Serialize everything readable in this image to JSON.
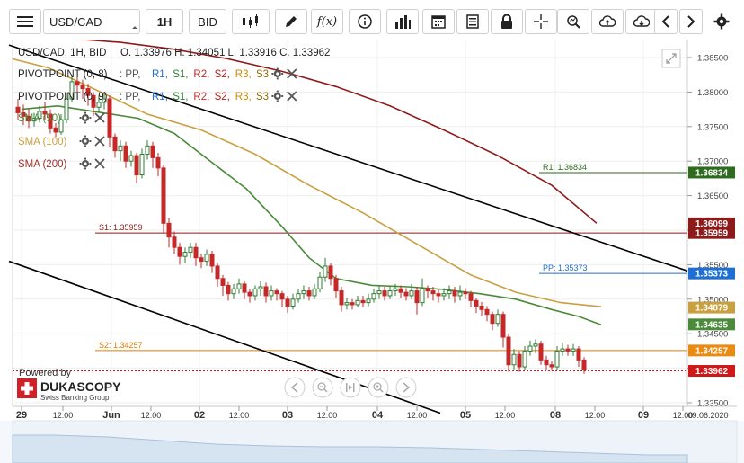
{
  "toolbar": {
    "symbol": "USD/CAD",
    "timeframe": "1H",
    "side": "BID",
    "indicator_btn": "f(x)"
  },
  "header": {
    "instrument_line": "USD/CAD, 1H, BID",
    "ohlc": "O. 1.33976 H. 1.34051 L. 1.33916 C. 1.33962"
  },
  "indicators": [
    {
      "label": "PIVOTPOINT (0, 8)",
      "parts": [
        ": PP,",
        "R1,",
        "S1,",
        "R2,",
        "S2,",
        "R3,",
        "S3"
      ],
      "colors": [
        "#555555",
        "#1e6fd1",
        "#2e7d32",
        "#c62828",
        "#b71c1c",
        "#d08a00",
        "#8a6d00",
        "#e6c200"
      ]
    },
    {
      "label": "PIVOTPOINT (0, 9)",
      "parts": [
        ": PP,",
        "R1,",
        "S1,",
        "R2,",
        "S2,",
        "R3,",
        "S3"
      ],
      "colors": [
        "#555555",
        "#1e6fd1",
        "#2e7d32",
        "#c62828",
        "#b71c1c",
        "#d08a00",
        "#8a6d00",
        "#e6c200"
      ]
    },
    {
      "label": "SMA (50)",
      "color": "#4a8a3a"
    },
    {
      "label": "SMA (100)",
      "color": "#c8a040"
    },
    {
      "label": "SMA (200)",
      "color": "#a0302c"
    }
  ],
  "branding": {
    "powered_by": "Powered by",
    "name": "DUKASCOPY",
    "tagline": "Swiss Banking Group"
  },
  "chart_data": {
    "type": "candlestick",
    "y_ticks": [
      "1.38500",
      "1.38000",
      "1.37500",
      "1.37000",
      "1.36500",
      "1.36000",
      "1.35500",
      "1.35000",
      "1.34500",
      "1.34000",
      "1.33500"
    ],
    "ylim": [
      1.3335,
      1.3875
    ],
    "x_ticks": [
      "29",
      "12:00",
      "Jun",
      "12:00",
      "02",
      "12:00",
      "03",
      "12:00",
      "04",
      "12:00",
      "05",
      "12:00",
      "08",
      "12:00",
      "09",
      "12:00"
    ],
    "x_end_label": "09.06.2020",
    "levels": [
      {
        "name": "R1",
        "label": "R1: 1.36834",
        "value": 1.36834,
        "color": "#2e6b1f",
        "badge": "1.36834"
      },
      {
        "name": "S1",
        "label": "S1: 1.35959",
        "value": 1.35959,
        "color": "#8b1a1a",
        "badge": "1.35959"
      },
      {
        "name": "PP",
        "label": "PP: 1.35373",
        "value": 1.35373,
        "color": "#1e6fd1",
        "badge": "1.35373"
      },
      {
        "name": "S2",
        "label": "S2: 1.34257",
        "value": 1.34257,
        "color": "#e07b00",
        "badge": "1.34257"
      }
    ],
    "sma_badges": [
      {
        "name": "SMA (200)",
        "value": 1.36099,
        "badge": "1.36099",
        "color": "#8b1a1a"
      },
      {
        "name": "SMA (100)",
        "value": 1.34879,
        "badge": "1.34879",
        "color": "#c8a040"
      },
      {
        "name": "SMA (50)",
        "value": 1.34635,
        "badge": "1.34635",
        "color": "#4a8a3a"
      }
    ],
    "last_price": {
      "value": 1.33962,
      "badge": "1.33962",
      "color": "#d01818"
    },
    "sma200": [
      [
        0,
        1.3885
      ],
      [
        60,
        1.3878
      ],
      [
        120,
        1.3872
      ],
      [
        180,
        1.3862
      ],
      [
        240,
        1.3848
      ],
      [
        300,
        1.383
      ],
      [
        360,
        1.3808
      ],
      [
        420,
        1.378
      ],
      [
        480,
        1.3745
      ],
      [
        540,
        1.3708
      ],
      [
        600,
        1.3665
      ],
      [
        650,
        1.361
      ]
    ],
    "sma100": [
      [
        0,
        1.3848
      ],
      [
        40,
        1.3835
      ],
      [
        90,
        1.3805
      ],
      [
        150,
        1.3768
      ],
      [
        210,
        1.3745
      ],
      [
        270,
        1.371
      ],
      [
        330,
        1.3665
      ],
      [
        390,
        1.3625
      ],
      [
        450,
        1.358
      ],
      [
        510,
        1.3535
      ],
      [
        560,
        1.351
      ],
      [
        610,
        1.3495
      ],
      [
        655,
        1.3489
      ]
    ],
    "sma50": [
      [
        10,
        1.3775
      ],
      [
        50,
        1.378
      ],
      [
        90,
        1.3772
      ],
      [
        140,
        1.3762
      ],
      [
        180,
        1.374
      ],
      [
        220,
        1.37
      ],
      [
        260,
        1.366
      ],
      [
        300,
        1.3605
      ],
      [
        330,
        1.356
      ],
      [
        360,
        1.353
      ],
      [
        400,
        1.352
      ],
      [
        440,
        1.3518
      ],
      [
        480,
        1.3514
      ],
      [
        520,
        1.3508
      ],
      [
        560,
        1.35
      ],
      [
        600,
        1.3485
      ],
      [
        630,
        1.3475
      ],
      [
        655,
        1.3463
      ]
    ],
    "trend_upper": [
      [
        10,
        1.3868
      ],
      [
        765,
        1.3541
      ]
    ],
    "trend_lower": [
      [
        10,
        1.3555
      ],
      [
        490,
        1.3335
      ]
    ],
    "candles": [
      [
        20,
        1.3778,
        1.377,
        1.379,
        1.376
      ],
      [
        26,
        1.377,
        1.3765,
        1.3782,
        1.3752
      ],
      [
        32,
        1.3765,
        1.3758,
        1.3775,
        1.3748
      ],
      [
        38,
        1.3758,
        1.3762,
        1.377,
        1.375
      ],
      [
        44,
        1.3762,
        1.3772,
        1.378,
        1.3756
      ],
      [
        50,
        1.3772,
        1.3768,
        1.3785,
        1.376
      ],
      [
        56,
        1.3768,
        1.3748,
        1.3775,
        1.374
      ],
      [
        62,
        1.3748,
        1.3742,
        1.3755,
        1.3735
      ],
      [
        68,
        1.3742,
        1.376,
        1.3768,
        1.3738
      ],
      [
        74,
        1.376,
        1.379,
        1.3798,
        1.3755
      ],
      [
        80,
        1.379,
        1.3815,
        1.3825,
        1.3785
      ],
      [
        86,
        1.3815,
        1.381,
        1.3822,
        1.38
      ],
      [
        92,
        1.381,
        1.3805,
        1.3818,
        1.379
      ],
      [
        98,
        1.3805,
        1.3795,
        1.3812,
        1.378
      ],
      [
        104,
        1.3795,
        1.3778,
        1.38,
        1.3765
      ],
      [
        110,
        1.3778,
        1.3785,
        1.3795,
        1.377
      ],
      [
        116,
        1.3785,
        1.379,
        1.38,
        1.3775
      ],
      [
        122,
        1.379,
        1.3735,
        1.3795,
        1.372
      ],
      [
        128,
        1.3735,
        1.3715,
        1.374,
        1.3705
      ],
      [
        134,
        1.3715,
        1.3722,
        1.373,
        1.37
      ],
      [
        140,
        1.3722,
        1.37,
        1.3728,
        1.369
      ],
      [
        146,
        1.37,
        1.3708,
        1.3715,
        1.3692
      ],
      [
        152,
        1.3708,
        1.368,
        1.3712,
        1.3668
      ],
      [
        158,
        1.368,
        1.371,
        1.3718,
        1.3675
      ],
      [
        164,
        1.371,
        1.3722,
        1.373,
        1.3702
      ],
      [
        170,
        1.3722,
        1.3705,
        1.3728,
        1.369
      ],
      [
        176,
        1.3705,
        1.369,
        1.3712,
        1.3678
      ],
      [
        182,
        1.369,
        1.361,
        1.3695,
        1.3595
      ],
      [
        188,
        1.361,
        1.359,
        1.3618,
        1.3575
      ],
      [
        194,
        1.359,
        1.3575,
        1.3598,
        1.3565
      ],
      [
        200,
        1.3575,
        1.3562,
        1.3582,
        1.355
      ],
      [
        206,
        1.3562,
        1.3568,
        1.3575,
        1.3552
      ],
      [
        212,
        1.3568,
        1.3575,
        1.3582,
        1.356
      ],
      [
        218,
        1.3575,
        1.356,
        1.3582,
        1.3548
      ],
      [
        224,
        1.356,
        1.3555,
        1.3566,
        1.3545
      ],
      [
        230,
        1.3555,
        1.3565,
        1.3572,
        1.3548
      ],
      [
        236,
        1.3565,
        1.3548,
        1.357,
        1.3538
      ],
      [
        242,
        1.3548,
        1.353,
        1.3552,
        1.3518
      ],
      [
        248,
        1.353,
        1.352,
        1.3535,
        1.3505
      ],
      [
        254,
        1.352,
        1.3508,
        1.3525,
        1.3498
      ],
      [
        260,
        1.3508,
        1.3515,
        1.3522,
        1.35
      ],
      [
        266,
        1.3515,
        1.3522,
        1.353,
        1.3508
      ],
      [
        272,
        1.3522,
        1.351,
        1.3526,
        1.35
      ],
      [
        278,
        1.351,
        1.3505,
        1.3515,
        1.3495
      ],
      [
        284,
        1.3505,
        1.3515,
        1.352,
        1.3498
      ],
      [
        290,
        1.3515,
        1.3518,
        1.3526,
        1.3505
      ],
      [
        296,
        1.3518,
        1.3505,
        1.3524,
        1.3495
      ],
      [
        302,
        1.3505,
        1.3512,
        1.352,
        1.3498
      ],
      [
        308,
        1.3512,
        1.3508,
        1.3516,
        1.3498
      ],
      [
        314,
        1.3508,
        1.35,
        1.3512,
        1.3488
      ],
      [
        320,
        1.35,
        1.349,
        1.3505,
        1.348
      ],
      [
        326,
        1.349,
        1.35,
        1.3508,
        1.3485
      ],
      [
        332,
        1.35,
        1.3508,
        1.3515,
        1.3495
      ],
      [
        338,
        1.3508,
        1.3512,
        1.352,
        1.35
      ],
      [
        344,
        1.3512,
        1.3505,
        1.3518,
        1.3498
      ],
      [
        350,
        1.3505,
        1.3515,
        1.3522,
        1.35
      ],
      [
        356,
        1.3515,
        1.3532,
        1.354,
        1.351
      ],
      [
        362,
        1.3532,
        1.3548,
        1.356,
        1.3525
      ],
      [
        368,
        1.3548,
        1.353,
        1.3552,
        1.352
      ],
      [
        374,
        1.353,
        1.3512,
        1.3535,
        1.3502
      ],
      [
        380,
        1.3512,
        1.3492,
        1.3518,
        1.3482
      ],
      [
        386,
        1.3492,
        1.3495,
        1.3502,
        1.3485
      ],
      [
        392,
        1.3495,
        1.3492,
        1.35,
        1.3485
      ],
      [
        398,
        1.3492,
        1.3498,
        1.3505,
        1.3488
      ],
      [
        404,
        1.3498,
        1.3495,
        1.3505,
        1.3488
      ],
      [
        410,
        1.3495,
        1.35,
        1.3508,
        1.349
      ],
      [
        416,
        1.35,
        1.3508,
        1.3515,
        1.3495
      ],
      [
        422,
        1.3508,
        1.3512,
        1.352,
        1.35
      ],
      [
        428,
        1.3512,
        1.3505,
        1.3518,
        1.3498
      ],
      [
        434,
        1.3505,
        1.3512,
        1.352,
        1.35
      ],
      [
        440,
        1.3512,
        1.3515,
        1.3522,
        1.3505
      ],
      [
        446,
        1.3515,
        1.351,
        1.352,
        1.3502
      ],
      [
        452,
        1.351,
        1.3505,
        1.3516,
        1.3498
      ],
      [
        458,
        1.3505,
        1.3512,
        1.3522,
        1.35
      ],
      [
        464,
        1.3512,
        1.3495,
        1.3518,
        1.3478
      ],
      [
        470,
        1.3495,
        1.3515,
        1.353,
        1.349
      ],
      [
        476,
        1.3515,
        1.3512,
        1.352,
        1.3502
      ],
      [
        482,
        1.3512,
        1.3508,
        1.3518,
        1.3498
      ],
      [
        488,
        1.3508,
        1.3505,
        1.3515,
        1.3495
      ],
      [
        494,
        1.3505,
        1.3508,
        1.3516,
        1.3498
      ],
      [
        500,
        1.3508,
        1.3512,
        1.352,
        1.35
      ],
      [
        506,
        1.3512,
        1.3505,
        1.3518,
        1.3495
      ],
      [
        512,
        1.3505,
        1.351,
        1.352,
        1.3498
      ],
      [
        518,
        1.351,
        1.3508,
        1.3516,
        1.35
      ],
      [
        524,
        1.3508,
        1.3498,
        1.3512,
        1.3488
      ],
      [
        530,
        1.3498,
        1.349,
        1.3502,
        1.348
      ],
      [
        536,
        1.349,
        1.3485,
        1.3496,
        1.3475
      ],
      [
        542,
        1.3485,
        1.3478,
        1.349,
        1.3468
      ],
      [
        548,
        1.3478,
        1.3465,
        1.3482,
        1.3455
      ],
      [
        554,
        1.3465,
        1.3478,
        1.3485,
        1.346
      ],
      [
        560,
        1.3478,
        1.3445,
        1.3482,
        1.343
      ],
      [
        566,
        1.3445,
        1.3405,
        1.345,
        1.3395
      ],
      [
        572,
        1.3405,
        1.342,
        1.3428,
        1.3398
      ],
      [
        578,
        1.342,
        1.3402,
        1.3425,
        1.3395
      ],
      [
        584,
        1.3402,
        1.3425,
        1.3432,
        1.3398
      ],
      [
        590,
        1.3425,
        1.3432,
        1.344,
        1.3418
      ],
      [
        596,
        1.3432,
        1.3435,
        1.3442,
        1.3422
      ],
      [
        602,
        1.3435,
        1.3412,
        1.344,
        1.3405
      ],
      [
        608,
        1.3412,
        1.3405,
        1.3418,
        1.3398
      ],
      [
        614,
        1.3405,
        1.3402,
        1.341,
        1.3396
      ],
      [
        620,
        1.3402,
        1.3425,
        1.3432,
        1.3398
      ],
      [
        626,
        1.3425,
        1.3428,
        1.3436,
        1.3418
      ],
      [
        632,
        1.3428,
        1.3425,
        1.3434,
        1.3418
      ],
      [
        638,
        1.3425,
        1.3428,
        1.3435,
        1.3418
      ],
      [
        644,
        1.3428,
        1.3412,
        1.3432,
        1.3402
      ],
      [
        650,
        1.3412,
        1.3398,
        1.3416,
        1.3392
      ]
    ]
  }
}
